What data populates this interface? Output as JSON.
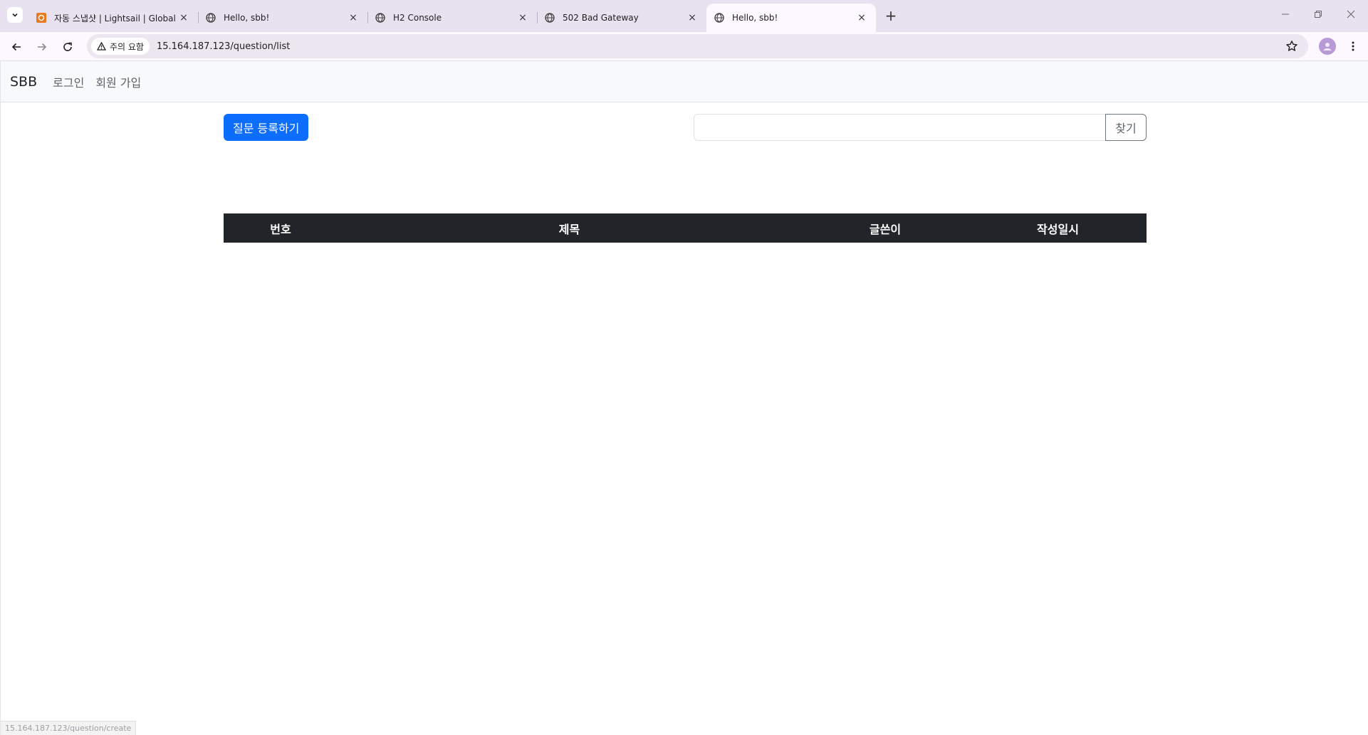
{
  "browser": {
    "tabs": [
      {
        "title": "자동 스냅샷 | Lightsail | Global",
        "favicon": "lightsail-icon",
        "active": false
      },
      {
        "title": "Hello, sbb!",
        "favicon": "globe-icon",
        "active": false
      },
      {
        "title": "H2 Console",
        "favicon": "globe-icon",
        "active": false
      },
      {
        "title": "502 Bad Gateway",
        "favicon": "globe-icon",
        "active": false
      },
      {
        "title": "Hello, sbb!",
        "favicon": "globe-icon",
        "active": true
      }
    ],
    "close_glyph": "×",
    "new_tab_glyph": "+",
    "security_label": "주의 요함",
    "url": "15.164.187.123/question/list",
    "status_url": "15.164.187.123/question/create"
  },
  "site": {
    "brand": "SBB",
    "nav": {
      "login": "로그인",
      "signup": "회원 가입"
    }
  },
  "main": {
    "create_button": "질문 등록하기",
    "search": {
      "value": "",
      "button": "찾기"
    },
    "table": {
      "headers": [
        "번호",
        "제목",
        "글쓴이",
        "작성일시"
      ],
      "rows": []
    }
  },
  "colors": {
    "primary": "#0d6efd",
    "table_header": "#212529",
    "navbar": "#f8f9fa"
  }
}
